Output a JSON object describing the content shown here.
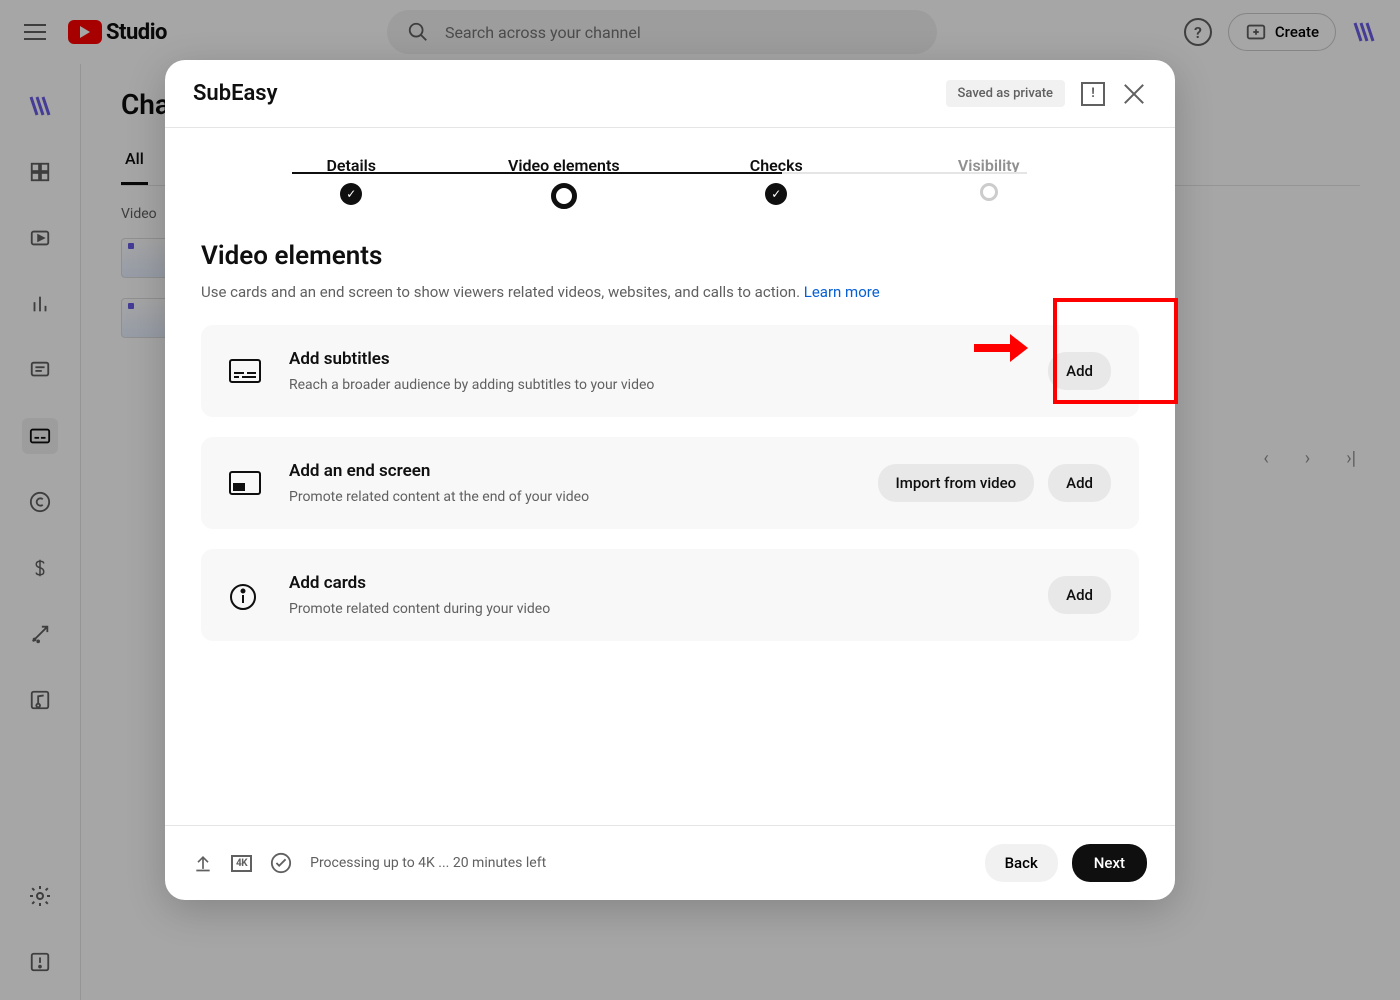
{
  "topbar": {
    "logo_text": "Studio",
    "search_placeholder": "Search across your channel",
    "create_label": "Create"
  },
  "page": {
    "title_partial": "Cha",
    "tab_all": "All",
    "video_label": "Video"
  },
  "modal": {
    "title": "SubEasy",
    "save_badge": "Saved as private",
    "steps": {
      "details": "Details",
      "video_elements": "Video elements",
      "checks": "Checks",
      "visibility": "Visibility"
    },
    "section": {
      "heading": "Video elements",
      "desc": "Use cards and an end screen to show viewers related videos, websites, and calls to action. ",
      "learn_more": "Learn more"
    },
    "cards": {
      "subtitles": {
        "title": "Add subtitles",
        "desc": "Reach a broader audience by adding subtitles to your video",
        "btn": "Add"
      },
      "endscreen": {
        "title": "Add an end screen",
        "desc": "Promote related content at the end of your video",
        "btn_import": "Import from video",
        "btn_add": "Add"
      },
      "cardsitem": {
        "title": "Add cards",
        "desc": "Promote related content during your video",
        "btn": "Add"
      }
    },
    "footer": {
      "quality": "4K",
      "status": "Processing up to 4K ... 20 minutes left",
      "back": "Back",
      "next": "Next"
    }
  }
}
